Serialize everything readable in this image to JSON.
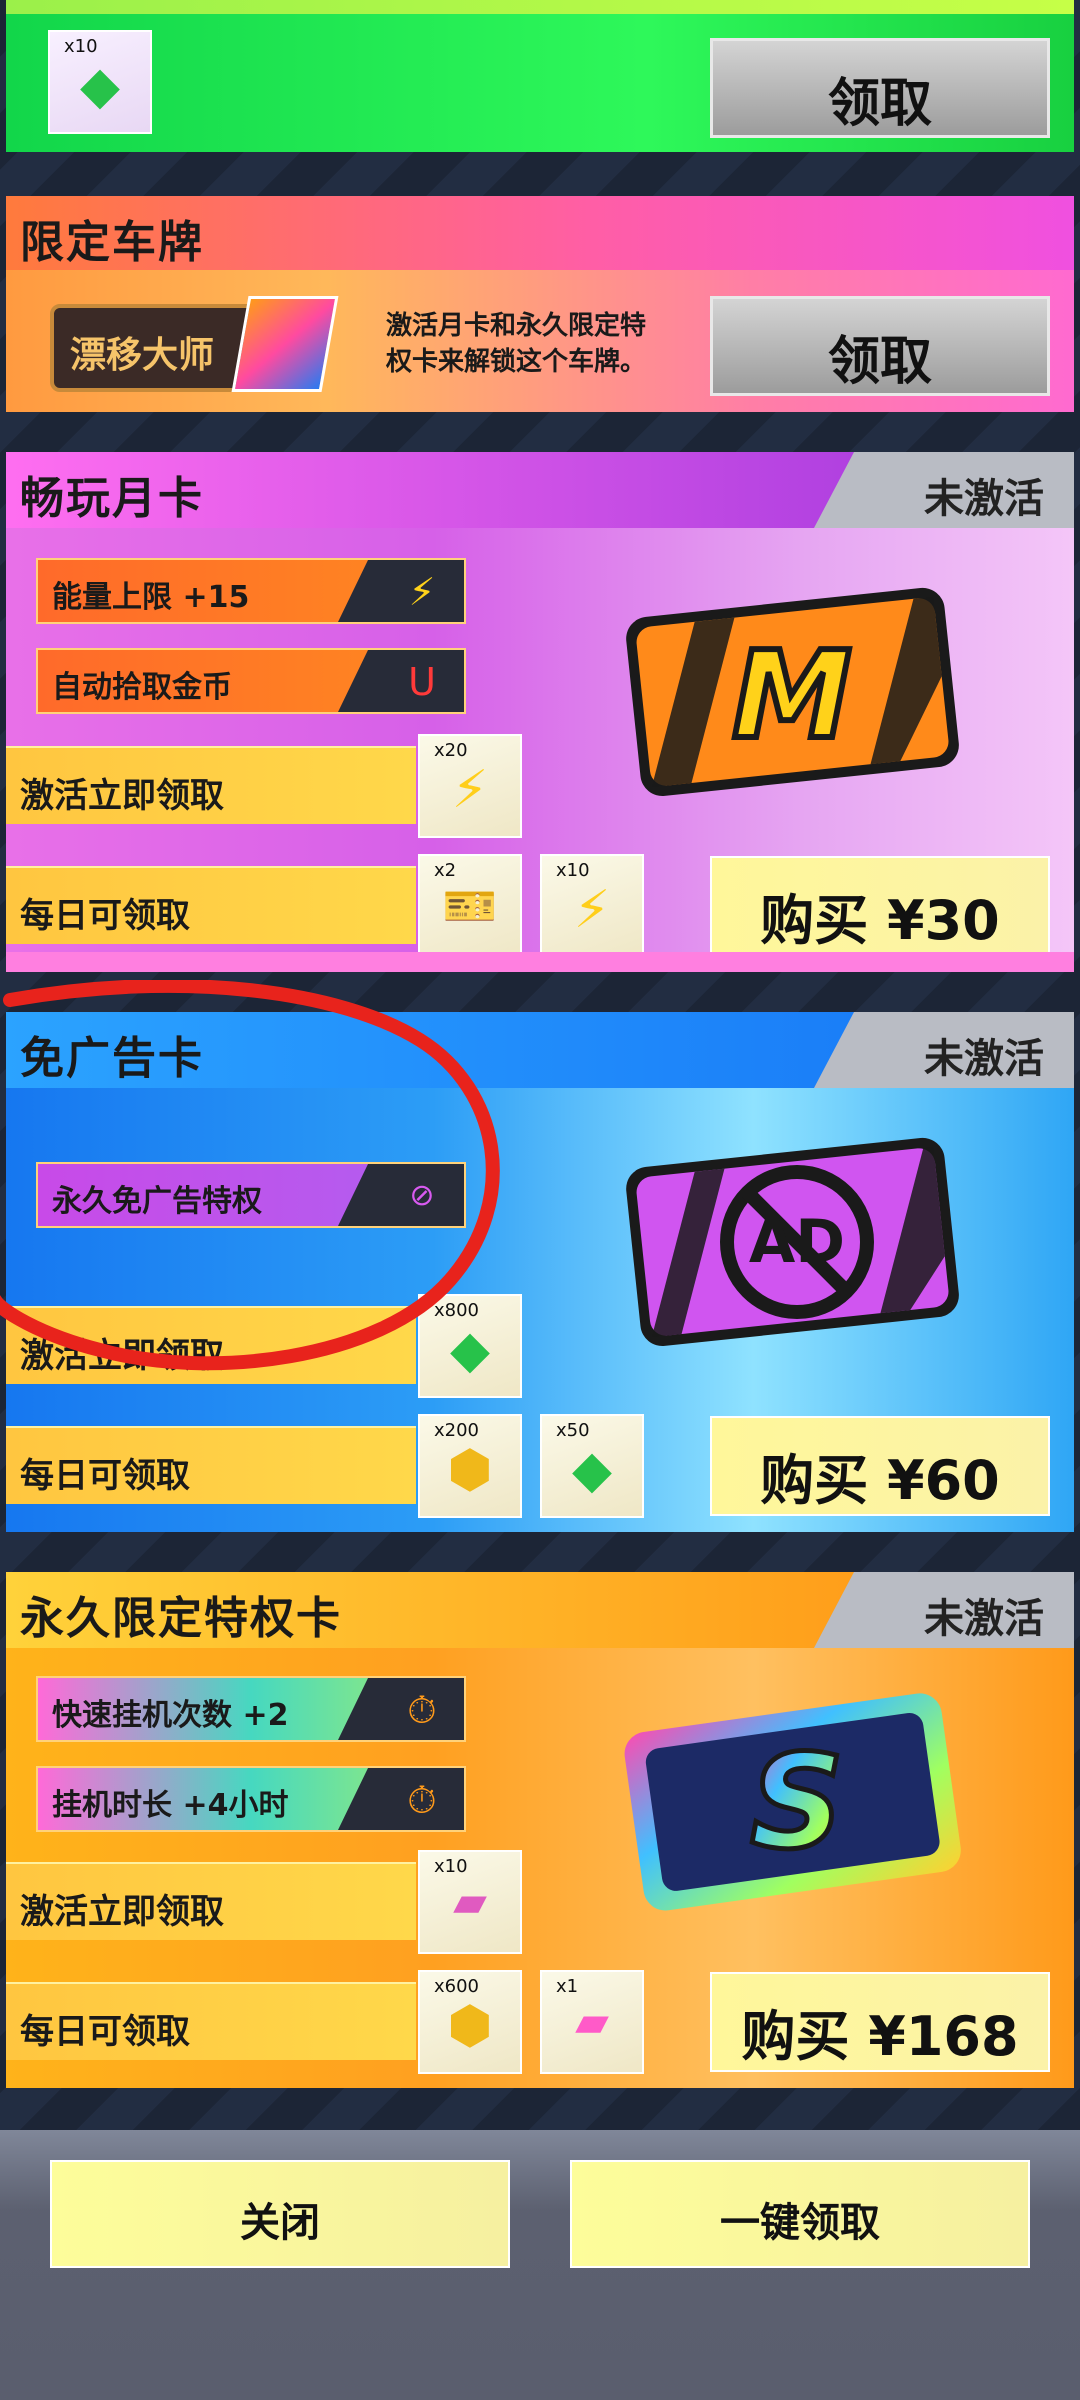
{
  "panel_reward_top": {
    "item_count": "x10",
    "item_icon": "green-gem-icon",
    "claim_label": "领取"
  },
  "license_plate": {
    "title": "限定车牌",
    "plate_text": "漂移大师",
    "description_line1": "激活月卡和永久限定特",
    "description_line2": "权卡来解锁这个车牌。",
    "claim_label": "领取"
  },
  "monthly_card": {
    "title": "畅玩月卡",
    "status": "未激活",
    "perks": [
      "能量上限 +15",
      "自动拾取金币"
    ],
    "activate_label": "激活立即领取",
    "daily_label": "每日可领取",
    "activate_items": [
      {
        "count": "x20",
        "icon": "energy-bolt-icon"
      }
    ],
    "daily_items": [
      {
        "count": "x2",
        "icon": "speed-hunter-ticket-icon"
      },
      {
        "count": "x10",
        "icon": "energy-bolt-icon"
      }
    ],
    "buy_label": "购买 ¥30",
    "card_letter": "M"
  },
  "no_ad_card": {
    "title": "免广告卡",
    "status": "未激活",
    "perks": [
      "永久免广告特权"
    ],
    "activate_label": "激活立即领取",
    "daily_label": "每日可领取",
    "activate_items": [
      {
        "count": "x800",
        "icon": "green-gem-icon"
      }
    ],
    "daily_items": [
      {
        "count": "x200",
        "icon": "gold-coin-icon"
      },
      {
        "count": "x50",
        "icon": "green-gem-icon"
      }
    ],
    "buy_label": "购买 ¥60",
    "card_text": "AD"
  },
  "permanent_card": {
    "title": "永久限定特权卡",
    "status": "未激活",
    "perks": [
      "快速挂机次数 +2",
      "挂机时长 +4小时"
    ],
    "activate_label": "激活立即领取",
    "daily_label": "每日可领取",
    "activate_items": [
      {
        "count": "x10",
        "icon": "pink-card-icon"
      }
    ],
    "daily_items": [
      {
        "count": "x600",
        "icon": "gold-coin-icon"
      },
      {
        "count": "x1",
        "icon": "rainbow-card-icon"
      }
    ],
    "buy_label": "购买 ¥168",
    "card_letter": "S"
  },
  "footer": {
    "close_label": "关闭",
    "claim_all_label": "一键领取"
  },
  "colors": {
    "annotation_red": "#e8231c",
    "button_yellow": "#fff79a",
    "status_gray": "#b9bcc4"
  }
}
